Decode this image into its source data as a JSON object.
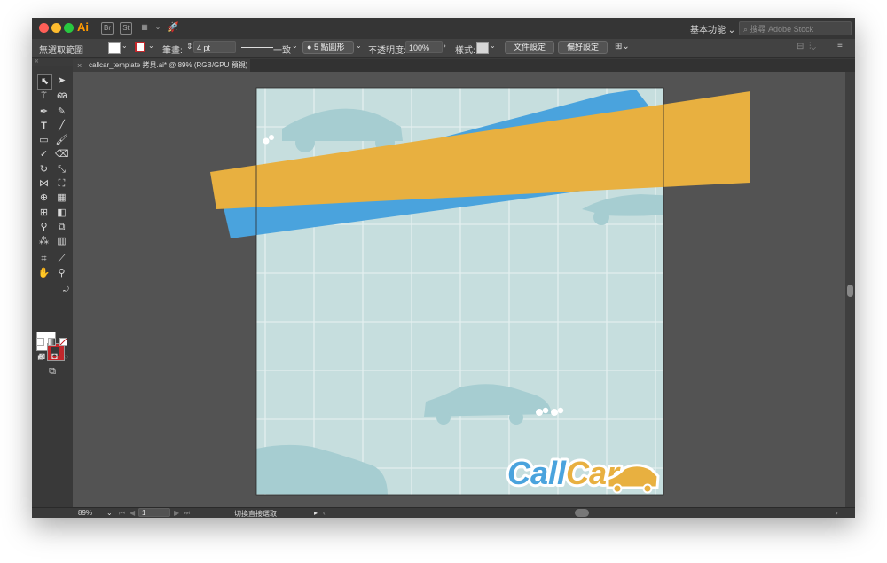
{
  "app": {
    "logo": "Ai"
  },
  "titlebar": {
    "bridge_label": "Br",
    "stock_label": "St",
    "workspace_label": "基本功能",
    "search_placeholder": "搜尋 Adobe Stock"
  },
  "control_bar": {
    "selection_label": "無選取範圍",
    "stroke_label": "筆畫:",
    "stroke_weight": "4 pt",
    "stroke_profile": "一致",
    "brush_label": "5 點圓形",
    "opacity_label": "不透明度:",
    "opacity_value": "100%",
    "style_label": "樣式:",
    "document_setup_button": "文件設定",
    "preferences_button": "偏好設定"
  },
  "tabs": [
    {
      "label": "callcar_template 拷貝.ai* @ 89% (RGB/GPU 預視)",
      "active": true
    }
  ],
  "artboard": {
    "background_color": "#c6dede",
    "grid_color": "#e3efef",
    "car_color": "#a6cdd1",
    "stripe_orange": "#e8b040",
    "stripe_blue": "#4aa3dd",
    "logo": {
      "part1": "Call",
      "part2": "Car",
      "part1_color": "#4aa3dd",
      "part2_color": "#e8b040"
    }
  },
  "status_bar": {
    "zoom": "89%",
    "artboard_number": "1",
    "tool_hint": "切換直接選取"
  }
}
